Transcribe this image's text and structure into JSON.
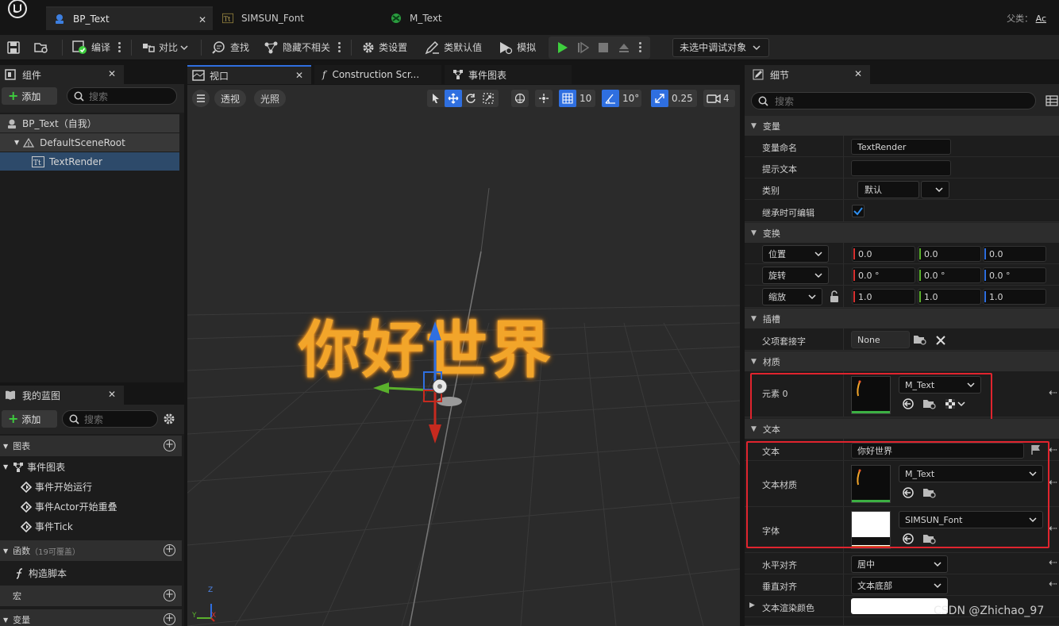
{
  "title_bar": {
    "tabs": [
      {
        "label": "BP_Text"
      },
      {
        "label": "SIMSUN_Font"
      },
      {
        "label": "M_Text"
      }
    ],
    "parent_label": "父类：",
    "parent_value": "Ac"
  },
  "toolbar": {
    "compile_label": "编译",
    "diff_label": "对比",
    "find_label": "查找",
    "hide_unrelated_label": "隐藏不相关",
    "class_settings_label": "类设置",
    "class_defaults_label": "类默认值",
    "simulate_label": "模拟",
    "debug_target_label": "未选中调试对象"
  },
  "components_panel": {
    "tab_label": "组件",
    "add_label": "添加",
    "search_placeholder": "搜索",
    "tree": [
      {
        "label": "BP_Text（自我）"
      },
      {
        "label": "DefaultSceneRoot"
      },
      {
        "label": "TextRender"
      }
    ]
  },
  "blueprint_panel": {
    "tab_label": "我的蓝图",
    "add_label": "添加",
    "search_placeholder": "搜索",
    "sections": {
      "graphs": "图表",
      "event_graph": "事件图表",
      "events": [
        "事件开始运行",
        "事件Actor开始重叠",
        "事件Tick"
      ],
      "functions": "函数",
      "functions_note": "（19可覆盖）",
      "construction_script": "构造脚本",
      "macros": "宏",
      "variables": "变量"
    }
  },
  "center_tabs": [
    {
      "label": "视口"
    },
    {
      "label": "Construction Scr..."
    },
    {
      "label": "事件图表"
    }
  ],
  "viewport": {
    "perspective_label": "透视",
    "lighting_label": "光照",
    "grid_snap": "10",
    "rotation_snap": "10°",
    "scale_snap": "0.25",
    "camera_speed": "4",
    "rendered_text": "你好世界",
    "axis_labels": {
      "z": "Z",
      "x": "X",
      "y": "Y"
    }
  },
  "details_panel": {
    "tab_label": "细节",
    "search_placeholder": "搜索",
    "sections": {
      "variable": "变量",
      "transform": "变换",
      "sockets": "插槽",
      "materials": "材质",
      "text": "文本"
    },
    "variable": {
      "name_label": "变量命名",
      "name_value": "TextRender",
      "tooltip_label": "提示文本",
      "tooltip_value": "",
      "category_label": "类别",
      "category_value": "默认",
      "editable_label": "继承时可编辑",
      "editable_checked": true
    },
    "transform": {
      "location_label": "位置",
      "location": [
        "0.0",
        "0.0",
        "0.0"
      ],
      "rotation_label": "旋转",
      "rotation": [
        "0.0 °",
        "0.0 °",
        "0.0 °"
      ],
      "scale_label": "缩放",
      "scale": [
        "1.0",
        "1.0",
        "1.0"
      ]
    },
    "sockets": {
      "parent_socket_label": "父项套接字",
      "parent_socket_value": "None"
    },
    "materials": {
      "element_label": "元素 0",
      "element_value": "M_Text"
    },
    "text": {
      "text_label": "文本",
      "text_value": "你好世界",
      "text_material_label": "文本材质",
      "text_material_value": "M_Text",
      "font_label": "字体",
      "font_value": "SIMSUN_Font",
      "halign_label": "水平对齐",
      "halign_value": "居中",
      "valign_label": "垂直对齐",
      "valign_value": "文本底部",
      "render_color_label": "文本渲染颜色"
    }
  },
  "watermark": "CSDN @Zhichao_97",
  "colors": {
    "accent_blue": "#2f6fe0",
    "play_green": "#3ecf3e",
    "highlight_red": "#e0242e",
    "text_orange": "#f2a52a"
  }
}
